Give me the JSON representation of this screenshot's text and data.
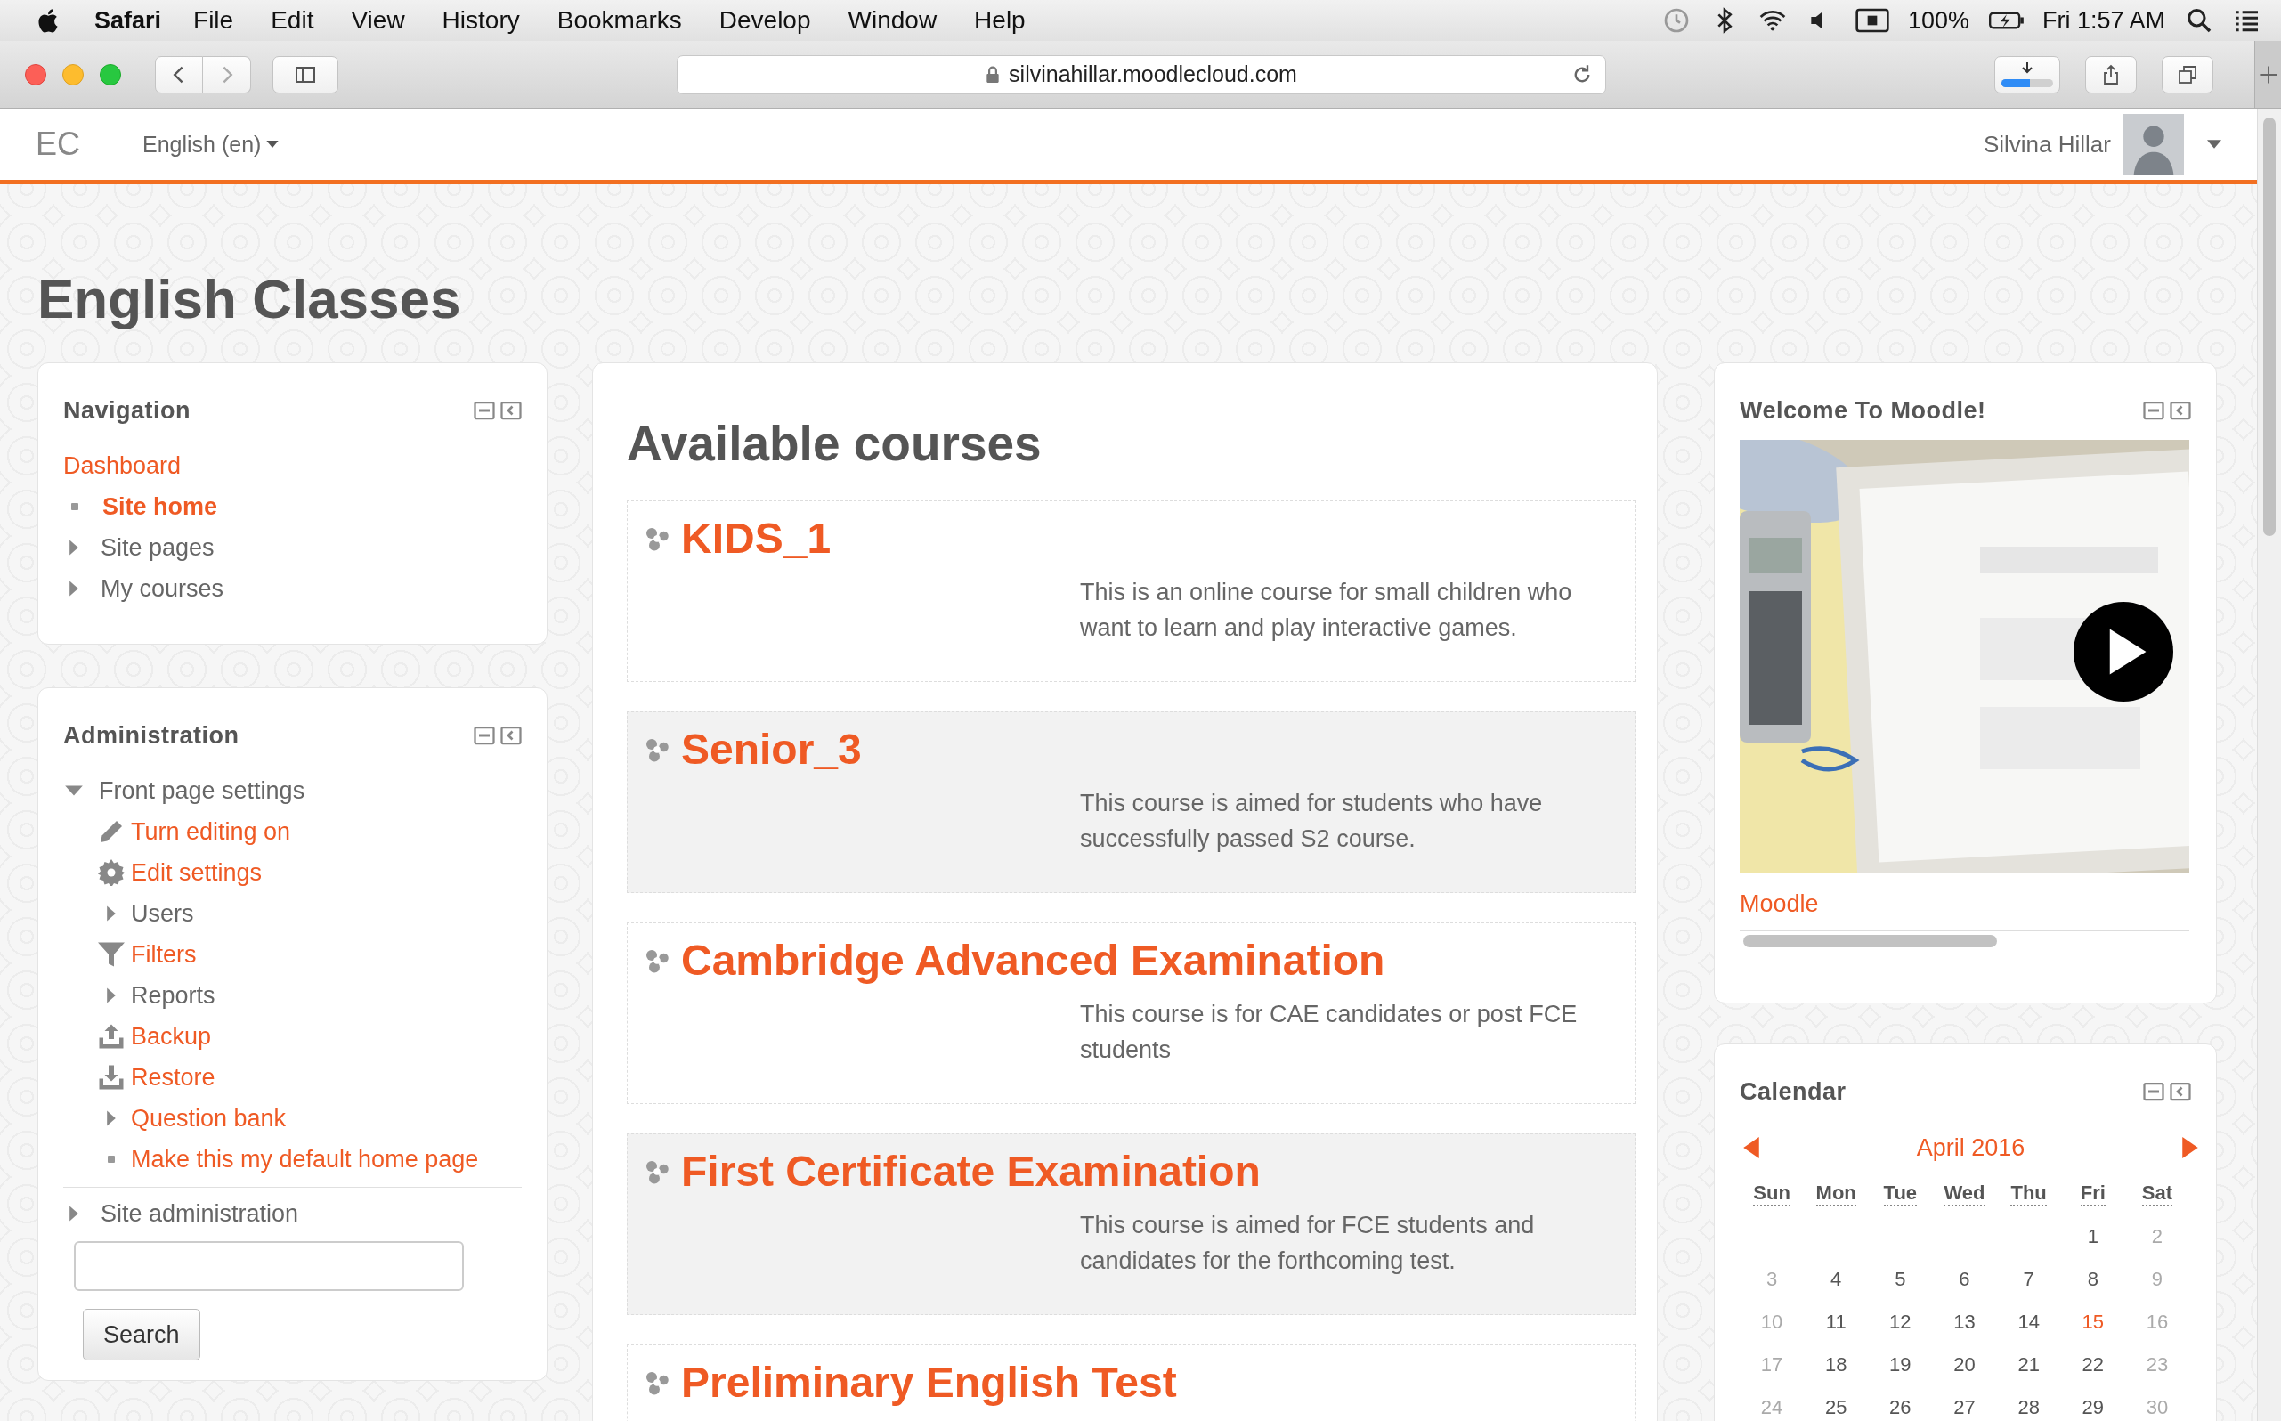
{
  "menu_bar": {
    "app": "Safari",
    "items": [
      "File",
      "Edit",
      "View",
      "History",
      "Bookmarks",
      "Develop",
      "Window",
      "Help"
    ],
    "battery": "100%",
    "clock": "Fri 1:57 AM"
  },
  "browser": {
    "url": "silvinahillar.moodlecloud.com",
    "download": {
      "level": 0.55
    }
  },
  "header": {
    "logo": "EC",
    "language": "English (en)",
    "user": "Silvina Hillar"
  },
  "site_title": "English Classes",
  "navigation": {
    "title": "Navigation",
    "home": "Dashboard",
    "items": [
      {
        "label": "Site home",
        "kind": "leaf",
        "selected": true
      },
      {
        "label": "Site pages",
        "kind": "branch",
        "selected": false
      },
      {
        "label": "My courses",
        "kind": "branch",
        "selected": false
      }
    ]
  },
  "administration": {
    "title": "Administration",
    "sections": [
      {
        "label": "Front page settings",
        "expanded": true,
        "children": [
          {
            "label": "Turn editing on",
            "kind": "edit",
            "link": true
          },
          {
            "label": "Edit settings",
            "kind": "settings",
            "link": true
          },
          {
            "label": "Users",
            "kind": "branch",
            "link": false
          },
          {
            "label": "Filters",
            "kind": "filter",
            "link": true
          },
          {
            "label": "Reports",
            "kind": "branch",
            "link": false
          },
          {
            "label": "Backup",
            "kind": "backup",
            "link": true
          },
          {
            "label": "Restore",
            "kind": "restore",
            "link": true
          },
          {
            "label": "Question bank",
            "kind": "branch",
            "link": true
          },
          {
            "label": "Make this my default home page",
            "kind": "leaf",
            "link": true
          }
        ]
      },
      {
        "label": "Site administration",
        "expanded": false
      }
    ],
    "search_button": "Search"
  },
  "courses": {
    "heading": "Available courses",
    "items": [
      {
        "name": "KIDS_1",
        "summary": "This is an online course for small children who want to learn and play interactive games."
      },
      {
        "name": "Senior_3",
        "summary": "This course is aimed for students who have successfully passed S2 course."
      },
      {
        "name": "Cambridge Advanced Examination",
        "summary": "This course is for CAE candidates or post FCE students"
      },
      {
        "name": "First Certificate Examination",
        "summary": "This course is aimed for FCE students and candidates for the forthcoming test."
      },
      {
        "name": "Preliminary English Test"
      }
    ]
  },
  "welcome": {
    "title": "Welcome To Moodle!",
    "link": "Moodle"
  },
  "calendar": {
    "title": "Calendar",
    "month": "April 2016",
    "weekdays": [
      "Sun",
      "Mon",
      "Tue",
      "Wed",
      "Thu",
      "Fri",
      "Sat"
    ],
    "weeks": [
      [
        {
          "label": "1",
          "today": false
        },
        {
          "label": "2",
          "today": false
        }
      ],
      [
        {
          "label": "3",
          "today": false
        },
        {
          "label": "4",
          "today": false
        },
        {
          "label": "5",
          "today": false
        },
        {
          "label": "6",
          "today": false
        },
        {
          "label": "7",
          "today": false
        },
        {
          "label": "8",
          "today": false
        },
        {
          "label": "9",
          "today": false
        }
      ],
      [
        {
          "label": "10",
          "today": false
        },
        {
          "label": "11",
          "today": false
        },
        {
          "label": "12",
          "today": false
        },
        {
          "label": "13",
          "today": false
        },
        {
          "label": "14",
          "today": false
        },
        {
          "label": "15",
          "today": true
        },
        {
          "label": "16",
          "today": false
        }
      ],
      [
        {
          "label": "17",
          "today": false
        },
        {
          "label": "18",
          "today": false
        },
        {
          "label": "19",
          "today": false
        },
        {
          "label": "20",
          "today": false
        },
        {
          "label": "21",
          "today": false
        },
        {
          "label": "22",
          "today": false
        },
        {
          "label": "23",
          "today": false
        }
      ],
      [
        {
          "label": "24",
          "today": false
        },
        {
          "label": "25",
          "today": false
        },
        {
          "label": "26",
          "today": false
        },
        {
          "label": "27",
          "today": false
        },
        {
          "label": "28",
          "today": false
        },
        {
          "label": "29",
          "today": false
        },
        {
          "label": "30",
          "today": false
        }
      ]
    ]
  }
}
